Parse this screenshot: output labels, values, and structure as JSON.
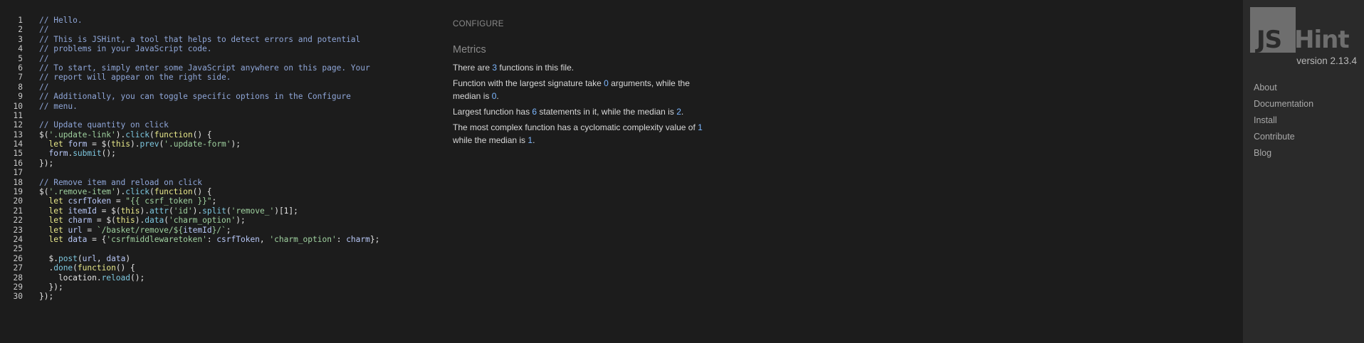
{
  "editor": {
    "lines": [
      {
        "n": "1",
        "parts": [
          {
            "t": "// Hello.",
            "c": "comment"
          }
        ]
      },
      {
        "n": "2",
        "parts": [
          {
            "t": "//",
            "c": "comment"
          }
        ]
      },
      {
        "n": "3",
        "parts": [
          {
            "t": "// This is JSHint, a tool that helps to detect errors and potential",
            "c": "comment"
          }
        ]
      },
      {
        "n": "4",
        "parts": [
          {
            "t": "// problems in your JavaScript code.",
            "c": "comment"
          }
        ]
      },
      {
        "n": "5",
        "parts": [
          {
            "t": "//",
            "c": "comment"
          }
        ]
      },
      {
        "n": "6",
        "parts": [
          {
            "t": "// To start, simply enter some JavaScript anywhere on this page. Your",
            "c": "comment"
          }
        ]
      },
      {
        "n": "7",
        "parts": [
          {
            "t": "// report will appear on the right side.",
            "c": "comment"
          }
        ]
      },
      {
        "n": "8",
        "parts": [
          {
            "t": "//",
            "c": "comment"
          }
        ]
      },
      {
        "n": "9",
        "parts": [
          {
            "t": "// Additionally, you can toggle specific options in the Configure",
            "c": "comment"
          }
        ]
      },
      {
        "n": "10",
        "parts": [
          {
            "t": "// menu.",
            "c": "comment"
          }
        ]
      },
      {
        "n": "11",
        "parts": []
      },
      {
        "n": "12",
        "parts": [
          {
            "t": "// Update quantity on click",
            "c": "comment"
          }
        ]
      },
      {
        "n": "13",
        "parts": [
          {
            "t": "$(",
            "c": ""
          },
          {
            "t": "'.update-link'",
            "c": "str"
          },
          {
            "t": ").",
            "c": ""
          },
          {
            "t": "click",
            "c": "fn"
          },
          {
            "t": "(",
            "c": ""
          },
          {
            "t": "function",
            "c": "kw"
          },
          {
            "t": "() {",
            "c": ""
          }
        ]
      },
      {
        "n": "14",
        "parts": [
          {
            "t": "  ",
            "c": ""
          },
          {
            "t": "let",
            "c": "kw"
          },
          {
            "t": " ",
            "c": ""
          },
          {
            "t": "form",
            "c": "var"
          },
          {
            "t": " = $(",
            "c": ""
          },
          {
            "t": "this",
            "c": "kw"
          },
          {
            "t": ").",
            "c": ""
          },
          {
            "t": "prev",
            "c": "fn"
          },
          {
            "t": "(",
            "c": ""
          },
          {
            "t": "'.update-form'",
            "c": "str"
          },
          {
            "t": ");",
            "c": ""
          }
        ]
      },
      {
        "n": "15",
        "parts": [
          {
            "t": "  ",
            "c": ""
          },
          {
            "t": "form",
            "c": "var"
          },
          {
            "t": ".",
            "c": ""
          },
          {
            "t": "submit",
            "c": "fn"
          },
          {
            "t": "();",
            "c": ""
          }
        ]
      },
      {
        "n": "16",
        "parts": [
          {
            "t": "});",
            "c": ""
          }
        ]
      },
      {
        "n": "17",
        "parts": []
      },
      {
        "n": "18",
        "parts": [
          {
            "t": "// Remove item and reload on click",
            "c": "comment"
          }
        ]
      },
      {
        "n": "19",
        "parts": [
          {
            "t": "$(",
            "c": ""
          },
          {
            "t": "'.remove-item'",
            "c": "str"
          },
          {
            "t": ").",
            "c": ""
          },
          {
            "t": "click",
            "c": "fn"
          },
          {
            "t": "(",
            "c": ""
          },
          {
            "t": "function",
            "c": "kw"
          },
          {
            "t": "() {",
            "c": ""
          }
        ]
      },
      {
        "n": "20",
        "parts": [
          {
            "t": "  ",
            "c": ""
          },
          {
            "t": "let",
            "c": "kw"
          },
          {
            "t": " ",
            "c": ""
          },
          {
            "t": "csrfToken",
            "c": "var"
          },
          {
            "t": " = ",
            "c": ""
          },
          {
            "t": "\"{{ csrf_token }}\"",
            "c": "str"
          },
          {
            "t": ";",
            "c": ""
          }
        ]
      },
      {
        "n": "21",
        "parts": [
          {
            "t": "  ",
            "c": ""
          },
          {
            "t": "let",
            "c": "kw"
          },
          {
            "t": " ",
            "c": ""
          },
          {
            "t": "itemId",
            "c": "var"
          },
          {
            "t": " = $(",
            "c": ""
          },
          {
            "t": "this",
            "c": "kw"
          },
          {
            "t": ").",
            "c": ""
          },
          {
            "t": "attr",
            "c": "fn"
          },
          {
            "t": "(",
            "c": ""
          },
          {
            "t": "'id'",
            "c": "str"
          },
          {
            "t": ").",
            "c": ""
          },
          {
            "t": "split",
            "c": "fn"
          },
          {
            "t": "(",
            "c": ""
          },
          {
            "t": "'remove_'",
            "c": "str"
          },
          {
            "t": ")[1];",
            "c": ""
          }
        ]
      },
      {
        "n": "22",
        "parts": [
          {
            "t": "  ",
            "c": ""
          },
          {
            "t": "let",
            "c": "kw"
          },
          {
            "t": " ",
            "c": ""
          },
          {
            "t": "charm",
            "c": "var"
          },
          {
            "t": " = $(",
            "c": ""
          },
          {
            "t": "this",
            "c": "kw"
          },
          {
            "t": ").",
            "c": ""
          },
          {
            "t": "data",
            "c": "fn"
          },
          {
            "t": "(",
            "c": ""
          },
          {
            "t": "'charm_option'",
            "c": "str"
          },
          {
            "t": ");",
            "c": ""
          }
        ]
      },
      {
        "n": "23",
        "parts": [
          {
            "t": "  ",
            "c": ""
          },
          {
            "t": "let",
            "c": "kw"
          },
          {
            "t": " ",
            "c": ""
          },
          {
            "t": "url",
            "c": "var"
          },
          {
            "t": " = ",
            "c": ""
          },
          {
            "t": "`/basket/remove/${",
            "c": "str"
          },
          {
            "t": "itemId",
            "c": "var"
          },
          {
            "t": "}/`",
            "c": "str"
          },
          {
            "t": ";",
            "c": ""
          }
        ]
      },
      {
        "n": "24",
        "parts": [
          {
            "t": "  ",
            "c": ""
          },
          {
            "t": "let",
            "c": "kw"
          },
          {
            "t": " ",
            "c": ""
          },
          {
            "t": "data",
            "c": "var"
          },
          {
            "t": " = {",
            "c": ""
          },
          {
            "t": "'csrfmiddlewaretoken'",
            "c": "str"
          },
          {
            "t": ": ",
            "c": ""
          },
          {
            "t": "csrfToken",
            "c": "var"
          },
          {
            "t": ", ",
            "c": ""
          },
          {
            "t": "'charm_option'",
            "c": "str"
          },
          {
            "t": ": ",
            "c": ""
          },
          {
            "t": "charm",
            "c": "var"
          },
          {
            "t": "};",
            "c": ""
          }
        ]
      },
      {
        "n": "25",
        "parts": []
      },
      {
        "n": "26",
        "parts": [
          {
            "t": "  $.",
            "c": ""
          },
          {
            "t": "post",
            "c": "fn"
          },
          {
            "t": "(",
            "c": ""
          },
          {
            "t": "url",
            "c": "var"
          },
          {
            "t": ", ",
            "c": ""
          },
          {
            "t": "data",
            "c": "var"
          },
          {
            "t": ")",
            "c": ""
          }
        ]
      },
      {
        "n": "27",
        "parts": [
          {
            "t": "  .",
            "c": ""
          },
          {
            "t": "done",
            "c": "fn"
          },
          {
            "t": "(",
            "c": ""
          },
          {
            "t": "function",
            "c": "kw"
          },
          {
            "t": "() {",
            "c": ""
          }
        ]
      },
      {
        "n": "28",
        "parts": [
          {
            "t": "    location.",
            "c": ""
          },
          {
            "t": "reload",
            "c": "fn"
          },
          {
            "t": "();",
            "c": ""
          }
        ]
      },
      {
        "n": "29",
        "parts": [
          {
            "t": "  });",
            "c": ""
          }
        ]
      },
      {
        "n": "30",
        "parts": [
          {
            "t": "});",
            "c": ""
          }
        ]
      }
    ]
  },
  "report": {
    "configure_label": "CONFIGURE",
    "metrics_title": "Metrics",
    "metrics": [
      [
        {
          "t": "There are "
        },
        {
          "t": "3",
          "num": true
        },
        {
          "t": " functions in this file."
        }
      ],
      [
        {
          "t": "Function with the largest signature take "
        },
        {
          "t": "0",
          "num": true
        },
        {
          "t": " arguments, while the median is "
        },
        {
          "t": "0",
          "num": true
        },
        {
          "t": "."
        }
      ],
      [
        {
          "t": "Largest function has "
        },
        {
          "t": "6",
          "num": true
        },
        {
          "t": " statements in it, while the median is "
        },
        {
          "t": "2",
          "num": true
        },
        {
          "t": "."
        }
      ],
      [
        {
          "t": "The most complex function has a cyclomatic complexity value of "
        },
        {
          "t": "1",
          "num": true
        },
        {
          "t": " while the median is "
        },
        {
          "t": "1",
          "num": true
        },
        {
          "t": "."
        }
      ]
    ]
  },
  "sidebar": {
    "logo_js": "JS",
    "logo_hint": "Hint",
    "version": "version 2.13.4",
    "nav": [
      {
        "label": "About"
      },
      {
        "label": "Documentation"
      },
      {
        "label": "Install"
      },
      {
        "label": "Contribute"
      },
      {
        "label": "Blog"
      }
    ]
  }
}
